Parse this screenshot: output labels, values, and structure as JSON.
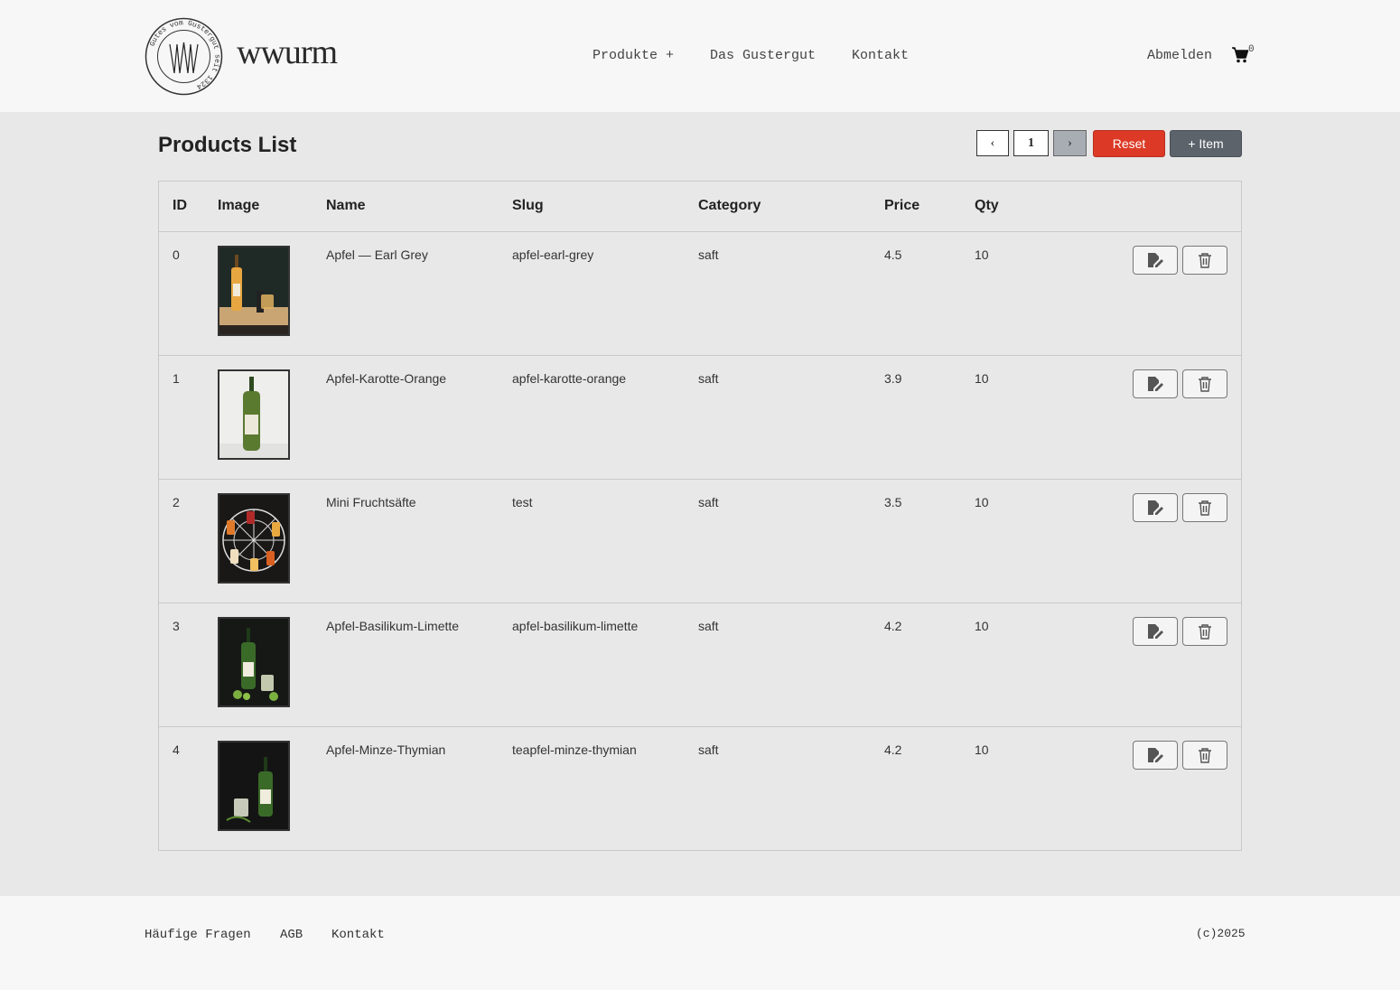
{
  "header": {
    "brand": "wwurm",
    "seal_text": "Gutes vom Gustergut seit 1324",
    "nav": {
      "produkte": "Produkte +",
      "gustergut": "Das Gustergut",
      "kontakt": "Kontakt"
    },
    "logout": "Abmelden",
    "cart_count": "0"
  },
  "main": {
    "title": "Products List",
    "pagination": {
      "prev": "‹",
      "current": "1",
      "next": "›"
    },
    "reset_label": "Reset",
    "add_label": "+ Item"
  },
  "table": {
    "columns": [
      "ID",
      "Image",
      "Name",
      "Slug",
      "Category",
      "Price",
      "Qty"
    ],
    "rows": [
      {
        "id": "0",
        "name": "Apfel — Earl Grey",
        "slug": "apfel-earl-grey",
        "category": "saft",
        "price": "4.5",
        "qty": "10"
      },
      {
        "id": "1",
        "name": "Apfel-Karotte-Orange",
        "slug": "apfel-karotte-orange",
        "category": "saft",
        "price": "3.9",
        "qty": "10"
      },
      {
        "id": "2",
        "name": "Mini Fruchtsäfte",
        "slug": "test",
        "category": "saft",
        "price": "3.5",
        "qty": "10"
      },
      {
        "id": "3",
        "name": "Apfel-Basilikum-Limette",
        "slug": "apfel-basilikum-limette",
        "category": "saft",
        "price": "4.2",
        "qty": "10"
      },
      {
        "id": "4",
        "name": "Apfel-Minze-Thymian",
        "slug": "teapfel-minze-thymian",
        "category": "saft",
        "price": "4.2",
        "qty": "10"
      }
    ]
  },
  "footer": {
    "faq": "Häufige Fragen",
    "agb": "AGB",
    "kontakt": "Kontakt",
    "copyright": "(c)2025"
  },
  "colors": {
    "reset": "#dc3a26",
    "add_item": "#5c636a",
    "page_bg": "#e8e8e8",
    "header_bg": "#f7f7f7"
  },
  "icons": [
    "cart-icon",
    "edit-icon",
    "trash-icon"
  ]
}
